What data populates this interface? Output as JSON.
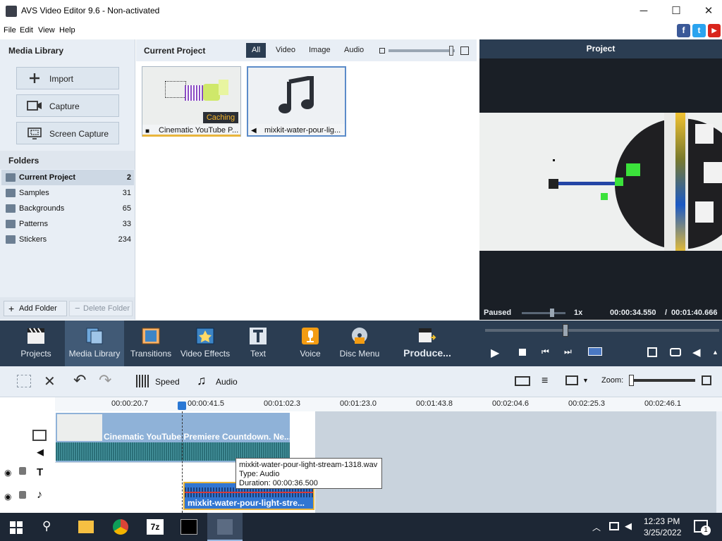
{
  "window": {
    "title": "AVS Video Editor 9.6 - Non-activated",
    "minimize": "─",
    "maximize": "☐",
    "close": "✕"
  },
  "menu": [
    "File",
    "Edit",
    "View",
    "Help"
  ],
  "social": {
    "facebook": "f",
    "twitter": "t",
    "youtube": "▶"
  },
  "media_library": {
    "title": "Media Library",
    "buttons": [
      "Import",
      "Capture",
      "Screen Capture"
    ],
    "folders_title": "Folders",
    "folders": [
      {
        "name": "Current Project",
        "count": "2"
      },
      {
        "name": "Samples",
        "count": "31"
      },
      {
        "name": "Backgrounds",
        "count": "65"
      },
      {
        "name": "Patterns",
        "count": "33"
      },
      {
        "name": "Stickers",
        "count": "234"
      }
    ],
    "add_folder": "Add Folder",
    "delete_folder": "Delete Folder"
  },
  "current_project": {
    "title": "Current Project",
    "tabs": [
      "All",
      "Video",
      "Image",
      "Audio"
    ],
    "items": [
      {
        "label": "Cinematic YouTube P...",
        "badge": "Caching"
      },
      {
        "label": "mixkit-water-pour-lig..."
      }
    ]
  },
  "preview": {
    "title": "Project",
    "status": "Paused",
    "speed": "1x",
    "time_current": "00:00:34.550",
    "time_sep": "/",
    "time_total": "00:01:40.666"
  },
  "toolbar": {
    "items": [
      "Projects",
      "Media Library",
      "Transitions",
      "Video Effects",
      "Text",
      "Voice",
      "Disc Menu"
    ],
    "produce": "Produce..."
  },
  "timeline_tools": {
    "speed": "Speed",
    "audio": "Audio",
    "zoom": "Zoom:"
  },
  "ruler": [
    "00:00:20.7",
    "00:00:41.5",
    "00:01:02.3",
    "00:01:23.0",
    "00:01:43.8",
    "00:02:04.6",
    "00:02:25.3",
    "00:02:46.1"
  ],
  "clips": {
    "video": "Cinematic YouTube Premiere Countdown. Ne...",
    "audio": "mixkit-water-pour-light-stre..."
  },
  "tooltip": {
    "line1": "mixkit-water-pour-light-stream-1318.wav",
    "line2": "Type: Audio",
    "line3": "Duration:  00:00:36.500"
  },
  "taskbar": {
    "time": "12:23 PM",
    "date": "3/25/2022",
    "notif_count": "1",
    "app_7z": "7z"
  }
}
